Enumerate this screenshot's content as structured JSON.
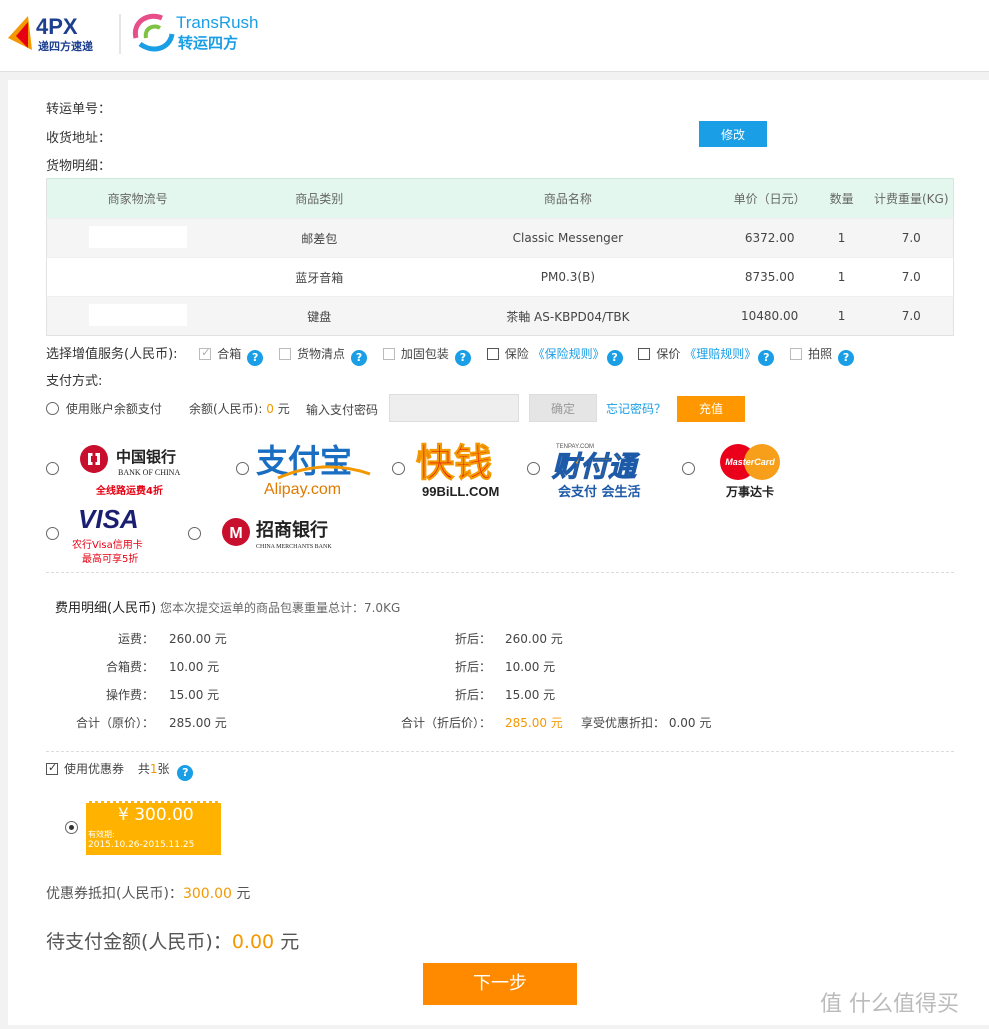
{
  "header": {
    "logo1_text": "4PX",
    "logo1_sub": "递四方速递",
    "logo2_text": "TransRush",
    "logo2_sub": "转运四方"
  },
  "info": {
    "tracking_label": "转运单号：",
    "address_label": "收货地址：",
    "modify_button": "修改",
    "goods_label": "货物明细："
  },
  "table": {
    "headers": [
      "商家物流号",
      "商品类别",
      "商品名称",
      "单价（日元）",
      "数量",
      "计费重量(KG)"
    ],
    "rows": [
      {
        "tracking": "",
        "category": "邮差包",
        "name": "Classic Messenger",
        "price": "6372.00",
        "qty": "1",
        "weight": "7.0"
      },
      {
        "tracking": "",
        "category": "蓝牙音箱",
        "name": "PM0.3(B)",
        "price": "8735.00",
        "qty": "1",
        "weight": "7.0"
      },
      {
        "tracking": "",
        "category": "键盘",
        "name": "茶軸 AS-KBPD04/TBK",
        "price": "10480.00",
        "qty": "1",
        "weight": "7.0"
      }
    ]
  },
  "services": {
    "label": "选择增值服务(人民币):",
    "items": [
      "合箱",
      "货物清点",
      "加固包装",
      "保险",
      "保价",
      "拍照"
    ],
    "insurance_rule": "《保险规则》",
    "claim_rule": "《理赔规则》",
    "help_glyph": "?"
  },
  "payment": {
    "label": "支付方式:",
    "balance_option": "使用账户余额支付",
    "balance_label": "余额(人民币):",
    "balance_value": "0",
    "balance_unit": "元",
    "password_label": "输入支付密码",
    "confirm_button": "确定",
    "forgot_link": "忘记密码？",
    "recharge_button": "充值",
    "methods": {
      "boc_name": "中国银行",
      "boc_en": "BANK OF CHINA",
      "boc_promo": "全线路运费4折",
      "alipay_name": "支付宝",
      "alipay_url": "Alipay.com",
      "kuaiqian_name": "快钱",
      "kuaiqian_url": "99BiLL.COM",
      "tenpay_name": "财付通",
      "tenpay_slogan": "会支付 会生活",
      "tenpay_small": "TENPAY.COM",
      "mastercard_name": "MasterCard",
      "mastercard_cn": "万事达卡",
      "visa_name": "VISA",
      "visa_promo1": "农行Visa信用卡",
      "visa_promo2": "最高可享5折",
      "cmb_name": "招商银行",
      "cmb_en": "CHINA MERCHANTS BANK"
    }
  },
  "fees": {
    "title": "费用明细(人民币)",
    "note": "您本次提交运单的商品包裹重量总计：7.0KG",
    "rows": [
      {
        "label": "运费：",
        "value": "260.00 元",
        "after_label": "折后：",
        "after_value": "260.00 元"
      },
      {
        "label": "合箱费：",
        "value": "10.00 元",
        "after_label": "折后：",
        "after_value": "10.00 元"
      },
      {
        "label": "操作费：",
        "value": "15.00 元",
        "after_label": "折后：",
        "after_value": "15.00 元"
      }
    ],
    "total_label": "合计（原价）：",
    "total_value": "285.00 元",
    "total_after_label": "合计（折后价）：",
    "total_after_value": "285.00 元",
    "discount_label": "享受优惠折扣：",
    "discount_value": "0.00 元"
  },
  "coupon": {
    "use_label": "使用优惠券",
    "count_prefix": "共",
    "count": "1",
    "count_suffix": "张",
    "amount": "¥ 300.00",
    "validity_label": "有效期:",
    "validity": "2015.10.26-2015.11.25",
    "deduct_label": "优惠券抵扣(人民币)：",
    "deduct_value": "300.00",
    "deduct_unit": "元"
  },
  "summary": {
    "pending_label": "待支付金额(人民币)：",
    "pending_value": "0.00",
    "pending_unit": "元",
    "next_button": "下一步"
  },
  "watermark": "值 什么值得买",
  "colors": {
    "accent_blue": "#1a9ee6",
    "accent_orange": "#ff9800",
    "table_header": "#e3f7ef"
  }
}
